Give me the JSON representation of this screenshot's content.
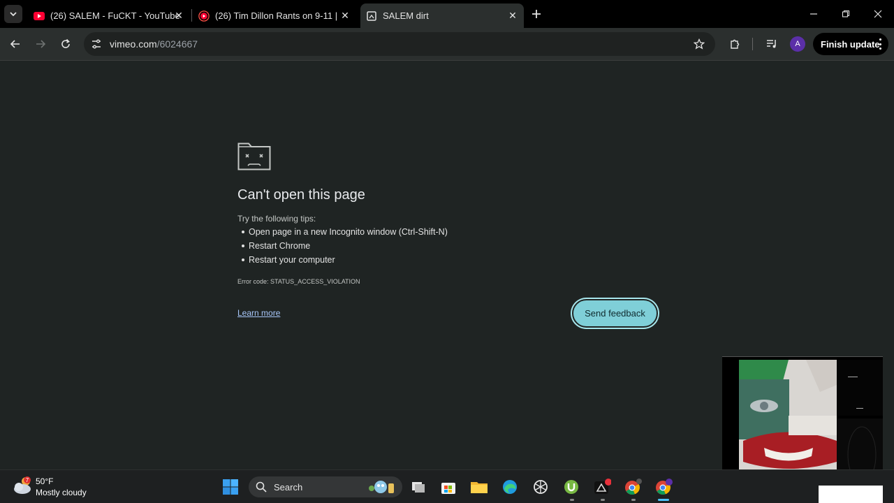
{
  "tabs": [
    {
      "title": "(26) SALEM - FuCKT - YouTube",
      "favicon": "youtube-icon"
    },
    {
      "title": "(26) Tim Dillon Rants on 9-11 |",
      "favicon": "youtube-live-icon"
    },
    {
      "title": "SALEM dirt",
      "favicon": "broken-page-icon",
      "active": true
    }
  ],
  "toolbar": {
    "url_host": "vimeo.com",
    "url_path": "/6024667",
    "avatar_letter": "A",
    "finish_update_label": "Finish update"
  },
  "error_page": {
    "title": "Can't open this page",
    "tips_heading": "Try the following tips:",
    "tips": [
      "Open page in a new Incognito window (Ctrl-Shift-N)",
      "Restart Chrome",
      "Restart your computer"
    ],
    "error_code": "Error code: STATUS_ACCESS_VIOLATION",
    "learn_more": "Learn more",
    "send_feedback": "Send feedback"
  },
  "taskbar": {
    "weather_temp": "50°F",
    "weather_condition": "Mostly cloudy",
    "weather_badge": "7",
    "search_label": "Search",
    "apps": [
      "start-icon",
      "task-view-icon",
      "store-icon",
      "file-explorer-icon",
      "edge-icon",
      "chatgpt-icon",
      "utorrent-icon",
      "app-icon",
      "chrome-icon",
      "chrome-profile-icon"
    ]
  },
  "colors": {
    "page_bg": "#1f2423",
    "accent_button": "#7fcfd8",
    "link": "#a8c7fa"
  }
}
